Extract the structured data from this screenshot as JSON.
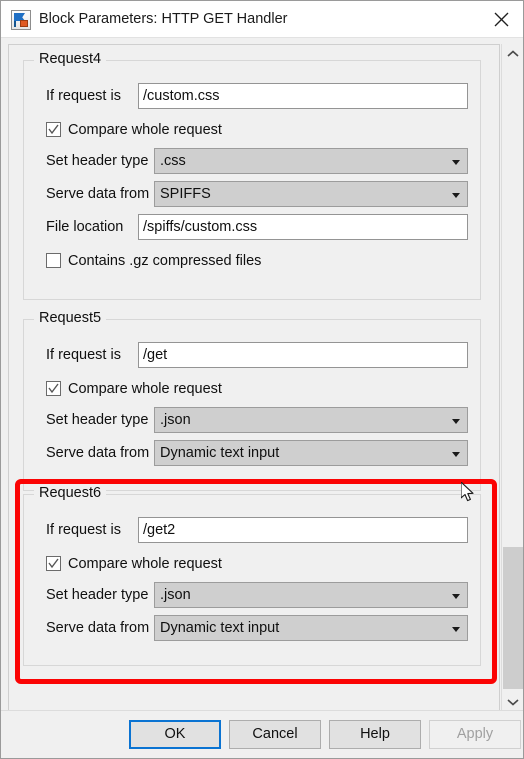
{
  "window": {
    "title": "Block Parameters: HTTP GET Handler",
    "icon": "simulink-block-icon",
    "close_icon": "close-icon"
  },
  "scrollbar": {
    "up_icon": "chevron-up-icon",
    "down_icon": "chevron-down-icon"
  },
  "groups": [
    {
      "title": "Request4",
      "if_request_label": "If request is",
      "if_request_value": "/custom.css",
      "compare_label": "Compare whole request",
      "compare_checked": true,
      "header_label": "Set header type",
      "header_value": ".css",
      "serve_label": "Serve data from",
      "serve_value": "SPIFFS",
      "file_label": "File location",
      "file_value": "/spiffs/custom.css",
      "gz_label": "Contains .gz compressed files",
      "gz_checked": false
    },
    {
      "title": "Request5",
      "if_request_label": "If request is",
      "if_request_value": "/get",
      "compare_label": "Compare whole request",
      "compare_checked": true,
      "header_label": "Set header type",
      "header_value": ".json",
      "serve_label": "Serve data from",
      "serve_value": "Dynamic text input"
    },
    {
      "title": "Request6",
      "if_request_label": "If request is",
      "if_request_value": "/get2",
      "compare_label": "Compare whole request",
      "compare_checked": true,
      "header_label": "Set header type",
      "header_value": ".json",
      "serve_label": "Serve data from",
      "serve_value": "Dynamic text input"
    }
  ],
  "annotation": {
    "color": "#fb0404",
    "target": "Request6"
  },
  "buttons": {
    "ok": "OK",
    "cancel": "Cancel",
    "help": "Help",
    "apply": "Apply",
    "apply_disabled": true
  }
}
